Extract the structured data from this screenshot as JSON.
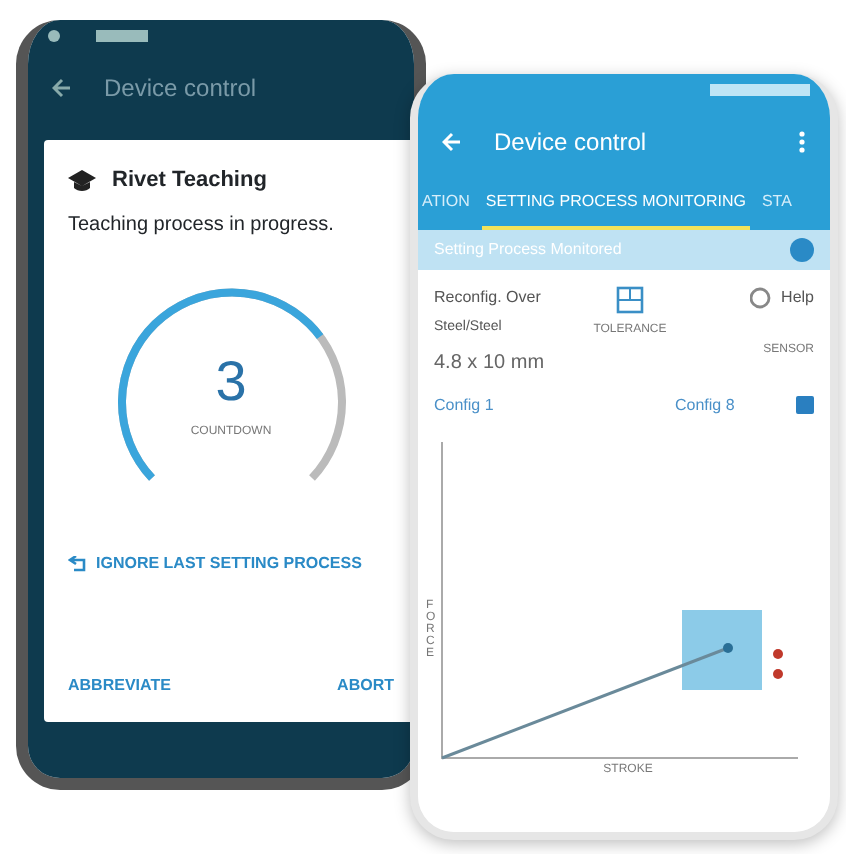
{
  "left_phone": {
    "app_bar": {
      "title": "Device control"
    },
    "dialog": {
      "title": "Rivet Teaching",
      "message": "Teaching process in progress.",
      "countdown": {
        "value": "3",
        "label": "COUNTDOWN"
      },
      "ignore_button": "IGNORE LAST SETTING PROCESS",
      "buttons": [
        "ABBREVIATE",
        "ABORT"
      ]
    }
  },
  "right_phone": {
    "app_bar": {
      "title": "Device control"
    },
    "tabs": [
      {
        "label": "ATION",
        "selected": false
      },
      {
        "label": "SETTING PROCESS MONITORING",
        "selected": true
      },
      {
        "label": "STA",
        "selected": false
      }
    ],
    "monitor_switch": {
      "label": "Setting Process Monitored",
      "on": true
    },
    "summary": {
      "title": "Reconfig. Over",
      "material": "Steel/Steel",
      "size": "4.8 x 10 mm",
      "tolerance": "TOLERANCE",
      "help": "Help",
      "sensor": "SENSOR"
    },
    "configs": [
      "Config 1",
      "Config 8"
    ],
    "config_checkbox": {
      "checked": true
    },
    "chart": {
      "ylabel": "FORCE",
      "xlabel": "STROKE"
    }
  }
}
